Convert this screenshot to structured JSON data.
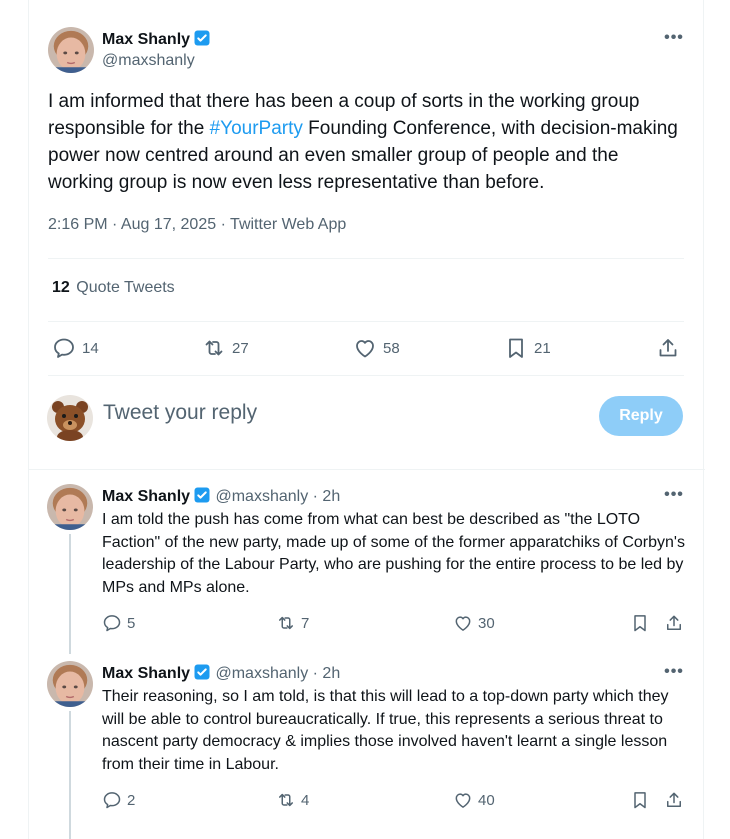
{
  "tweet": {
    "author_name": "Max Shanly",
    "author_handle": "@maxshanly",
    "text_before": "I am informed that there has been a coup of sorts in the working group responsible for the ",
    "hashtag": "#YourParty",
    "text_after": " Founding Conference, with decision-making power now centred around an even smaller group of people and the working group is now even less representative than before.",
    "meta": "2:16 PM · Aug 17, 2025 · Twitter Web App",
    "quote_count": "12",
    "quote_label": "Quote Tweets",
    "actions": {
      "replies": "14",
      "retweets": "27",
      "likes": "58",
      "bookmarks": "21"
    }
  },
  "compose": {
    "placeholder": "Tweet your reply",
    "button_label": "Reply"
  },
  "replies": [
    {
      "author_name": "Max Shanly",
      "author_handle": "@maxshanly",
      "time": "· 2h",
      "text": "I am told the push has come from what can best be described as \"the LOTO Faction\" of the new party, made up of some of the former apparatchiks of Corbyn's leadership of the Labour Party, who are pushing for the entire process to be led by MPs and MPs alone.",
      "actions": {
        "replies": "5",
        "retweets": "7",
        "likes": "30"
      }
    },
    {
      "author_name": "Max Shanly",
      "author_handle": "@maxshanly",
      "time": "· 2h",
      "text": "Their reasoning, so I am told, is that this will lead to a top-down party which they will be able to control bureaucratically. If true, this represents a serious threat to nascent party democracy & implies those involved haven't learnt a single lesson from their time in Labour.",
      "actions": {
        "replies": "2",
        "retweets": "4",
        "likes": "40"
      }
    }
  ],
  "colors": {
    "accent": "#1d9bf0",
    "muted": "#536471",
    "reply_button": "#8ecdf8"
  }
}
